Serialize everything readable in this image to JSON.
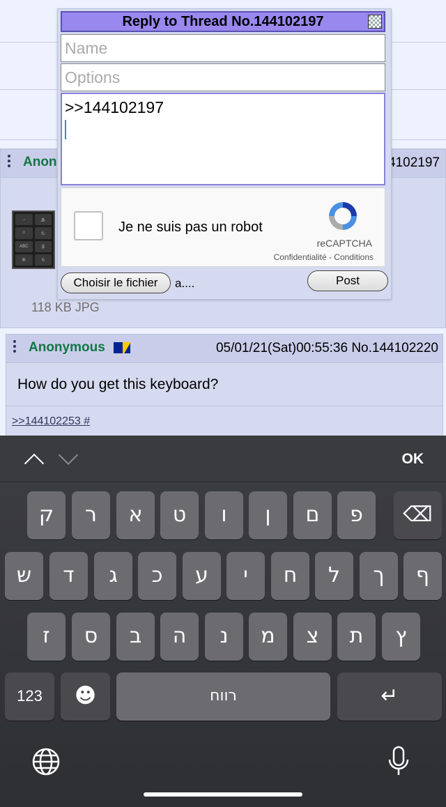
{
  "dialog": {
    "title": "Reply to Thread No.144102197",
    "name_placeholder": "Name",
    "options_placeholder": "Options",
    "comment_value": ">>144102197",
    "captcha_label": "Je ne suis pas un robot",
    "captcha_brand": "reCAPTCHA",
    "captcha_links": "Confidentialité - Conditions",
    "file_button": "Choisir le fichier",
    "file_name": "a....",
    "post_button": "Post"
  },
  "post1": {
    "name_partial": "Anon",
    "number_partial": "4102197",
    "fileinfo": "118 KB JPG"
  },
  "post2": {
    "name": "Anonymous",
    "meta": "05/01/21(Sat)00:55:36 No.144102220",
    "text": "How do you get this keyboard?",
    "backlink": ">>144102253 #"
  },
  "thumb_keys": [
    "→",
    "あ",
    "☺",
    "た",
    "ABC",
    "ま",
    "◍",
    "ら"
  ],
  "keyboard": {
    "ok_label": "OK",
    "row1": [
      "ק",
      "ר",
      "א",
      "ט",
      "ו",
      "ן",
      "ם",
      "פ"
    ],
    "row2": [
      "ש",
      "ד",
      "ג",
      "כ",
      "ע",
      "י",
      "ח",
      "ל",
      "ך",
      "ף"
    ],
    "row3": [
      "ז",
      "ס",
      "ב",
      "ה",
      "נ",
      "מ",
      "צ",
      "ת",
      "ץ"
    ],
    "numbers_label": "123",
    "space_label": "רווח",
    "emoji_glyph": "☻",
    "backspace_glyph": "⌫",
    "return_glyph": "↵"
  }
}
